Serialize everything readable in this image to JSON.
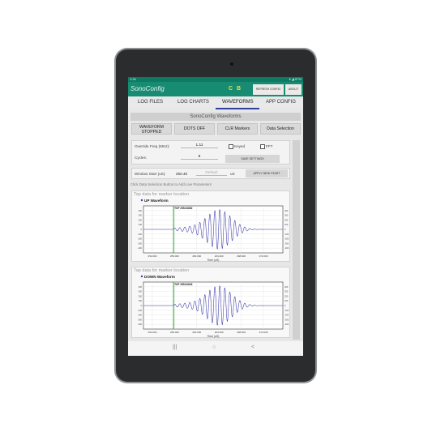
{
  "status": {
    "time": "1:34",
    "right": "▾ ◢ 87%"
  },
  "app": {
    "title": "SonoConfig",
    "indicators": [
      "C",
      "B"
    ],
    "indicator_color": "#e8e24a",
    "refresh_label": "REFRESH CONFIG",
    "about_label": "ABOUT",
    "accent": "#178c72"
  },
  "tabs": [
    {
      "label": "LOG FILES",
      "active": false
    },
    {
      "label": "LOG CHARTS",
      "active": false
    },
    {
      "label": "WAVEFORMS",
      "active": true
    },
    {
      "label": "APP CONFIG",
      "active": false
    }
  ],
  "section_title": "SonoConfig Waveforms",
  "buttons": {
    "waveform": "WAVEFORM STOPPED",
    "dots": "DOTS OFF",
    "clr": "CLR Markers",
    "data_selection": "Data Selection"
  },
  "params": {
    "override_label": "Override Freq (MHz):",
    "override_value": "1.11",
    "keyed_label": "Keyed",
    "fft_label": "FFT",
    "cycles_label": "Cycles:",
    "cycles_value": "8",
    "save_label": "SAVE SETTINGS",
    "window_label": "Window Start (uS):",
    "window_value": "250.40",
    "default_placeholder": "Default",
    "units": "uS",
    "apply_label": "APPLY NEW START"
  },
  "hint": "Click Data Selection Button to Add Live Parameters",
  "chart_data": [
    {
      "type": "line",
      "tap_hint": "Tap data for marker location",
      "series": [
        {
          "name": "UP Waveform",
          "color": "#3a3aa8"
        }
      ],
      "marker_label": "TOF 255.81662",
      "marker_x": 255.81662,
      "marker_color": "#1fa81f",
      "xlabel": "Time (uS)",
      "xlim": [
        250.4,
        275.5
      ],
      "x_ticks": [
        "252.000",
        "256.000",
        "260.000",
        "264.000",
        "268.000",
        "272.000"
      ],
      "ylim": [
        -500,
        500
      ],
      "y_ticks": [
        "400",
        "300",
        "200",
        "100",
        "0",
        "-100",
        "-200",
        "-300",
        "-400"
      ],
      "burst_center": 264.0,
      "burst_width": 3.2,
      "freq_mhz": 1.11,
      "peak": 420,
      "grid": true
    },
    {
      "type": "line",
      "tap_hint": "Tap data for marker location",
      "series": [
        {
          "name": "DOWN Waveform",
          "color": "#3a3aa8"
        }
      ],
      "marker_label": "TOF 255.81843",
      "marker_x": 255.81843,
      "marker_color": "#1fa81f",
      "xlabel": "Time (uS)",
      "xlim": [
        250.4,
        275.5
      ],
      "x_ticks": [
        "252.000",
        "256.000",
        "260.000",
        "264.000",
        "268.000",
        "272.000"
      ],
      "ylim": [
        -500,
        500
      ],
      "y_ticks": [
        "400",
        "300",
        "200",
        "100",
        "0",
        "-100",
        "-200",
        "-300",
        "-400"
      ],
      "burst_center": 264.0,
      "burst_width": 3.2,
      "freq_mhz": 1.11,
      "peak": 420,
      "grid": true
    }
  ],
  "nav": {
    "recent": "|||",
    "home": "○",
    "back": "<"
  }
}
